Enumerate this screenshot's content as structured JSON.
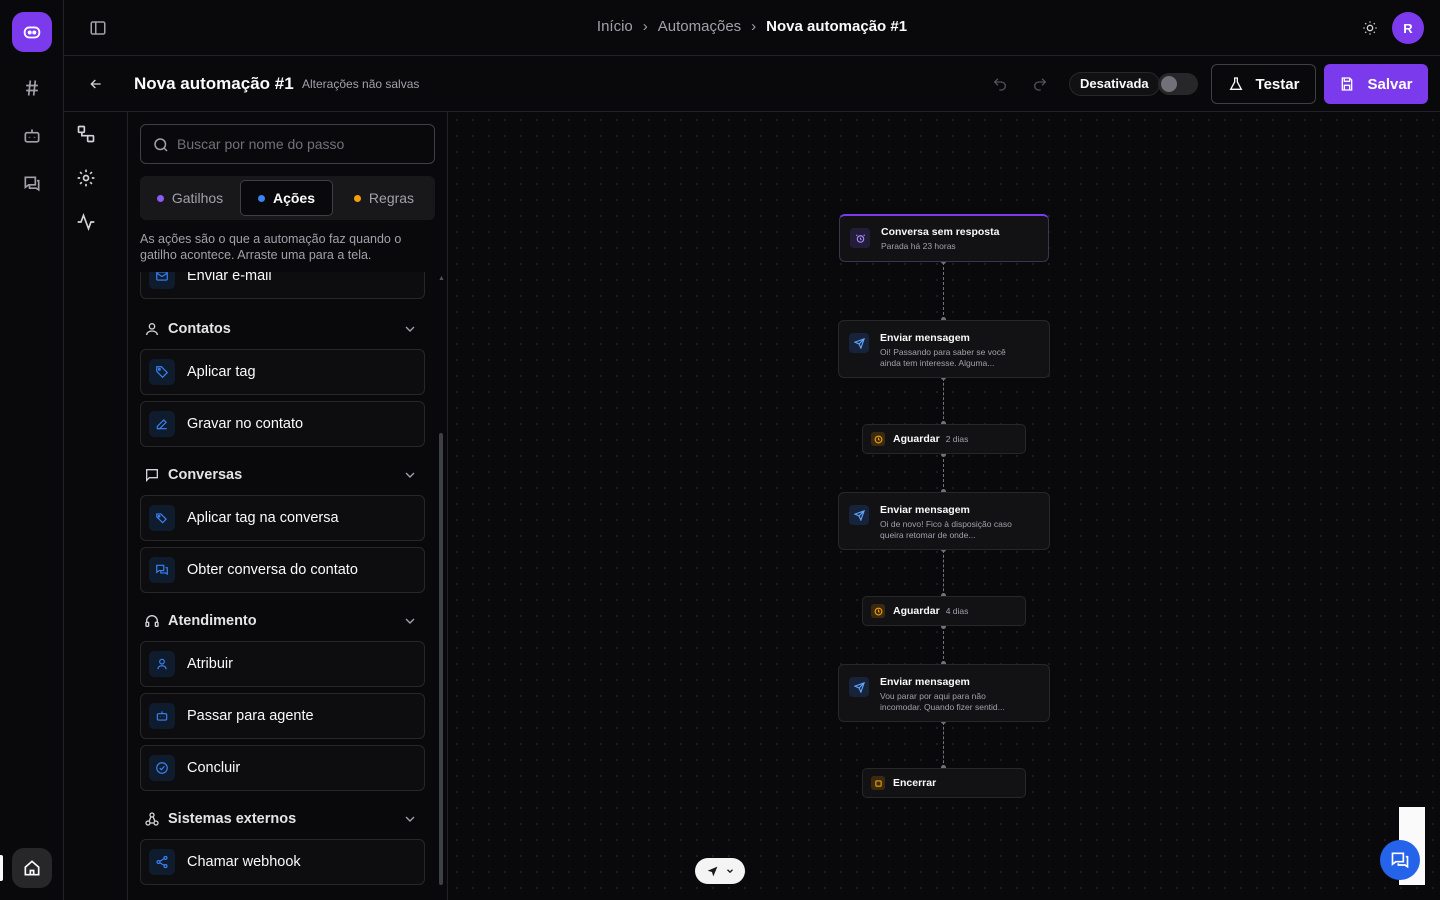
{
  "breadcrumb": {
    "items": [
      "Início",
      "Automações",
      "Nova automação #1"
    ]
  },
  "user": {
    "avatar_initial": "R"
  },
  "editor": {
    "title": "Nova automação #1",
    "unsaved_label": "Alterações não salvas",
    "status_label": "Desativada",
    "active": false,
    "test_label": "Testar",
    "save_label": "Salvar"
  },
  "panel": {
    "search_placeholder": "Buscar por nome do passo",
    "tabs": [
      {
        "label": "Gatilhos",
        "dot_color": "#8b5cf6",
        "active": false
      },
      {
        "label": "Ações",
        "dot_color": "#3b82f6",
        "active": true
      },
      {
        "label": "Regras",
        "dot_color": "#f59e0b",
        "active": false
      }
    ],
    "description": "As ações são o que a automação faz quando o gatilho acontece. Arraste uma para a tela.",
    "partial_item": "Enviar e-mail",
    "sections": [
      {
        "title": "Contatos",
        "icon": "user-icon",
        "items": [
          "Aplicar tag",
          "Gravar no contato"
        ]
      },
      {
        "title": "Conversas",
        "icon": "chat-icon",
        "items": [
          "Aplicar tag na conversa",
          "Obter conversa do contato"
        ]
      },
      {
        "title": "Atendimento",
        "icon": "headset-icon",
        "items": [
          "Atribuir",
          "Passar para agente",
          "Concluir"
        ]
      },
      {
        "title": "Sistemas externos",
        "icon": "webhook-icon",
        "items": [
          "Chamar webhook"
        ]
      }
    ]
  },
  "flow": {
    "trigger": {
      "title": "Conversa sem resposta",
      "subtitle": "Parada há 23 horas"
    },
    "send1": {
      "title": "Enviar mensagem",
      "text": "Oi! Passando para saber se você ainda tem interesse. Alguma..."
    },
    "wait1": {
      "title": "Aguardar",
      "duration": "2 dias"
    },
    "send2": {
      "title": "Enviar mensagem",
      "text": "Oi de novo! Fico à disposição caso queira retomar de onde..."
    },
    "wait2": {
      "title": "Aguardar",
      "duration": "4 dias"
    },
    "send3": {
      "title": "Enviar mensagem",
      "text": "Vou parar por aqui para não incomodar. Quando fizer sentid..."
    },
    "end": {
      "title": "Encerrar"
    }
  },
  "colors": {
    "accent": "#7c3aed",
    "action_blue": "#3b82f6",
    "wait_amber": "#f59e0b"
  }
}
